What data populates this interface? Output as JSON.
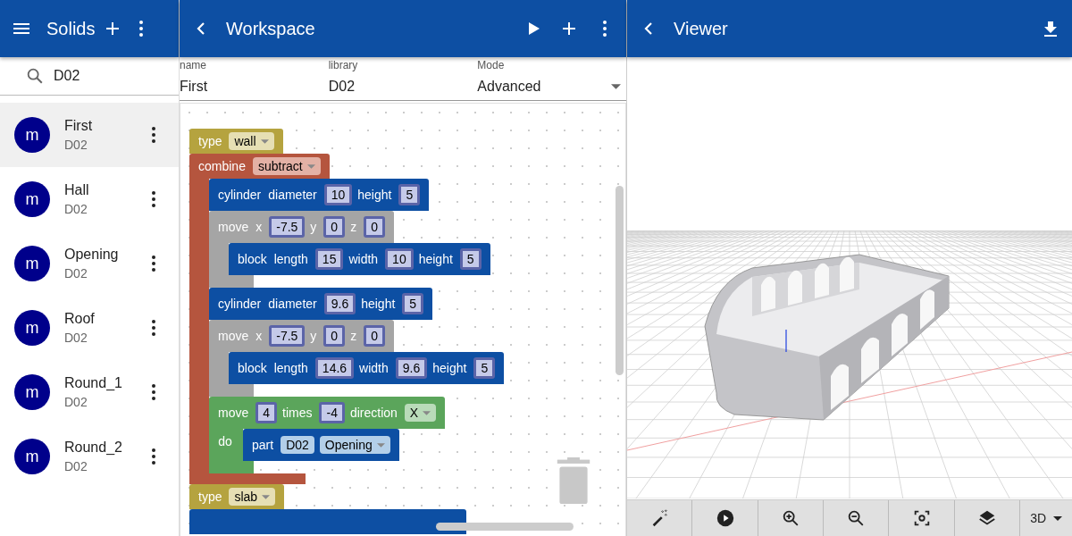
{
  "solids": {
    "title": "Solids",
    "search": {
      "value": "D02"
    },
    "items": [
      {
        "avatar": "m",
        "name": "First",
        "library": "D02",
        "selected": true
      },
      {
        "avatar": "m",
        "name": "Hall",
        "library": "D02",
        "selected": false
      },
      {
        "avatar": "m",
        "name": "Opening",
        "library": "D02",
        "selected": false
      },
      {
        "avatar": "m",
        "name": "Roof",
        "library": "D02",
        "selected": false
      },
      {
        "avatar": "m",
        "name": "Round_1",
        "library": "D02",
        "selected": false
      },
      {
        "avatar": "m",
        "name": "Round_2",
        "library": "D02",
        "selected": false
      }
    ]
  },
  "workspace": {
    "title": "Workspace",
    "fields": [
      {
        "kind": "text",
        "label": "name",
        "value": "First"
      },
      {
        "kind": "text",
        "label": "library",
        "value": "D02"
      },
      {
        "kind": "select",
        "label": "Mode",
        "value": "Advanced"
      }
    ],
    "blocks": [
      {
        "kind": "type",
        "parts": [
          {
            "kind": "label",
            "text": "type"
          },
          {
            "kind": "dropdown",
            "text": "wall"
          }
        ]
      },
      {
        "kind": "combine",
        "parts": [
          {
            "kind": "label",
            "text": "combine"
          },
          {
            "kind": "dropdown",
            "text": "subtract"
          }
        ],
        "children": [
          {
            "kind": "shape",
            "parts": [
              {
                "kind": "label",
                "text": "cylinder"
              },
              {
                "kind": "label",
                "text": "diameter"
              },
              {
                "kind": "number",
                "text": "10"
              },
              {
                "kind": "label",
                "text": "height"
              },
              {
                "kind": "number",
                "text": "5"
              }
            ]
          },
          {
            "kind": "move",
            "parts": [
              {
                "kind": "label",
                "text": "move"
              },
              {
                "kind": "label",
                "text": "x"
              },
              {
                "kind": "number",
                "text": "-7.5"
              },
              {
                "kind": "label",
                "text": "y"
              },
              {
                "kind": "number",
                "text": "0"
              },
              {
                "kind": "label",
                "text": "z"
              },
              {
                "kind": "number",
                "text": "0"
              }
            ],
            "children": [
              {
                "kind": "shape",
                "parts": [
                  {
                    "kind": "label",
                    "text": "block"
                  },
                  {
                    "kind": "label",
                    "text": "length"
                  },
                  {
                    "kind": "number",
                    "text": "15"
                  },
                  {
                    "kind": "label",
                    "text": "width"
                  },
                  {
                    "kind": "number",
                    "text": "10"
                  },
                  {
                    "kind": "label",
                    "text": "height"
                  },
                  {
                    "kind": "number",
                    "text": "5"
                  }
                ]
              }
            ]
          },
          {
            "kind": "shape",
            "parts": [
              {
                "kind": "label",
                "text": "cylinder"
              },
              {
                "kind": "label",
                "text": "diameter"
              },
              {
                "kind": "number",
                "text": "9.6"
              },
              {
                "kind": "label",
                "text": "height"
              },
              {
                "kind": "number",
                "text": "5"
              }
            ]
          },
          {
            "kind": "move",
            "parts": [
              {
                "kind": "label",
                "text": "move"
              },
              {
                "kind": "label",
                "text": "x"
              },
              {
                "kind": "number",
                "text": "-7.5"
              },
              {
                "kind": "label",
                "text": "y"
              },
              {
                "kind": "number",
                "text": "0"
              },
              {
                "kind": "label",
                "text": "z"
              },
              {
                "kind": "number",
                "text": "0"
              }
            ],
            "children": [
              {
                "kind": "shape",
                "parts": [
                  {
                    "kind": "label",
                    "text": "block"
                  },
                  {
                    "kind": "label",
                    "text": "length"
                  },
                  {
                    "kind": "number",
                    "text": "14.6"
                  },
                  {
                    "kind": "label",
                    "text": "width"
                  },
                  {
                    "kind": "number",
                    "text": "9.6"
                  },
                  {
                    "kind": "label",
                    "text": "height"
                  },
                  {
                    "kind": "number",
                    "text": "5"
                  }
                ]
              }
            ]
          },
          {
            "kind": "repeat",
            "parts": [
              {
                "kind": "label",
                "text": "move"
              },
              {
                "kind": "number",
                "text": "4"
              },
              {
                "kind": "label",
                "text": "times"
              },
              {
                "kind": "number",
                "text": "-4"
              },
              {
                "kind": "label",
                "text": "direction"
              },
              {
                "kind": "dropdown",
                "text": "X"
              }
            ],
            "do_label": "do",
            "children": [
              {
                "kind": "part",
                "parts": [
                  {
                    "kind": "label",
                    "text": "part"
                  },
                  {
                    "kind": "chip",
                    "text": "D02"
                  },
                  {
                    "kind": "dropdown",
                    "text": "Opening"
                  }
                ]
              }
            ]
          }
        ]
      },
      {
        "kind": "type",
        "parts": [
          {
            "kind": "label",
            "text": "type"
          },
          {
            "kind": "dropdown",
            "text": "slab"
          }
        ]
      },
      {
        "kind": "shape"
      }
    ]
  },
  "viewer": {
    "title": "Viewer",
    "view_mode": "3D"
  }
}
